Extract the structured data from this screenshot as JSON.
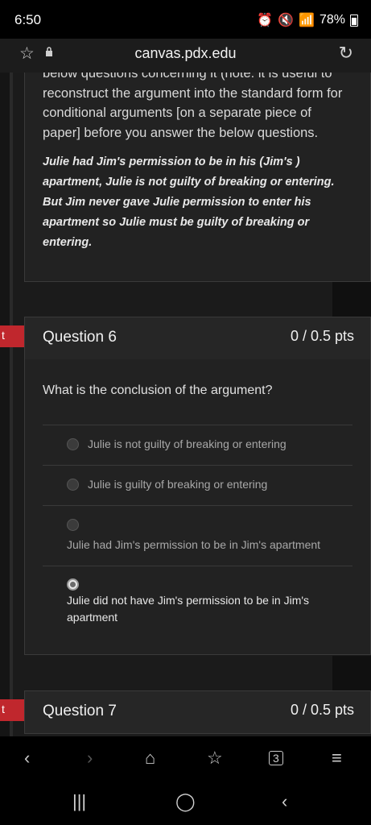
{
  "status": {
    "time": "6:50",
    "battery": "78%"
  },
  "browser": {
    "url": "canvas.pdx.edu"
  },
  "intro": {
    "description": "below questions concerning it (note: it is useful to reconstruct the argument into the standard form for conditional arguments [on a separate piece of paper] before you answer the below questions.",
    "quote": "Julie had Jim's permission to be in his (Jim's ) apartment, Julie is not guilty of breaking or entering. But Jim never gave Julie permission to enter his apartment so Julie must be guilty of breaking or entering."
  },
  "flag_label": "t",
  "question6": {
    "title": "Question 6",
    "points": "0 / 0.5 pts",
    "prompt": "What is the conclusion of the argument?",
    "answers": [
      {
        "label": "Julie is not guilty of breaking or entering",
        "selected": false
      },
      {
        "label": "Julie is guilty of breaking or entering",
        "selected": false
      },
      {
        "label": "Julie had Jim's permission to be in Jim's apartment",
        "selected": false
      },
      {
        "label": "Julie did not have Jim's permission to be in Jim's apartment",
        "selected": true
      }
    ]
  },
  "question7": {
    "title": "Question 7",
    "points": "0 / 0.5 pts"
  },
  "browser_nav": {
    "tabs_count": "3"
  },
  "icons": [
    "star-icon",
    "lock-icon",
    "reload-icon",
    "back-icon",
    "forward-icon",
    "home-icon",
    "bookmarks-icon",
    "tabs-icon",
    "menu-icon",
    "recents-icon",
    "home-circle-icon",
    "system-back-icon"
  ]
}
